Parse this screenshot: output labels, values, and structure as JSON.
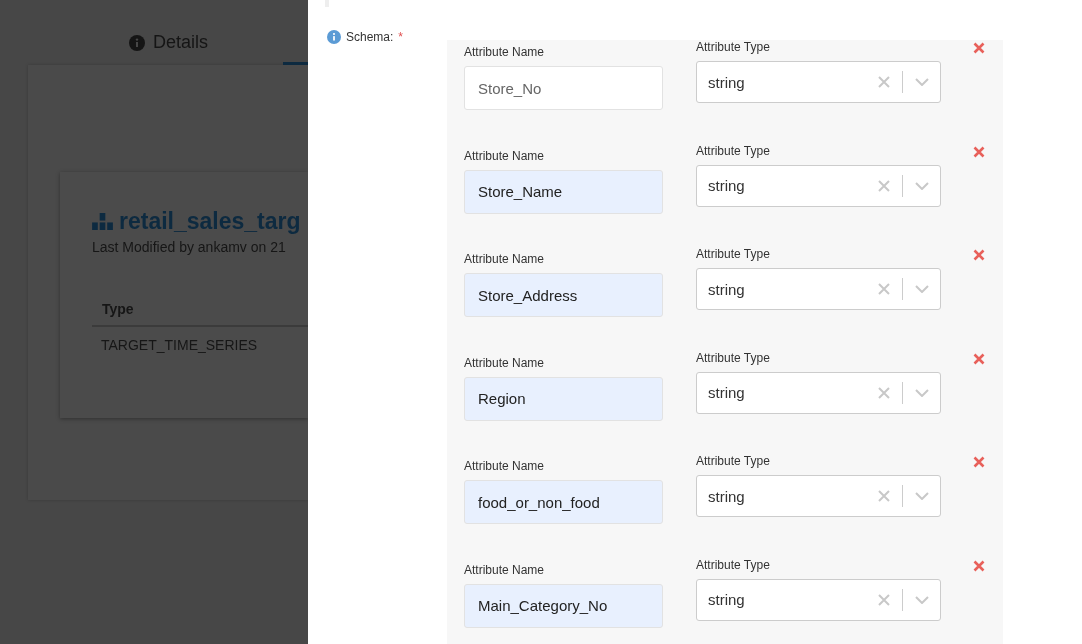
{
  "background_page": {
    "tab": {
      "label": "Details"
    },
    "dataset": {
      "title": "retail_sales_targ",
      "modified": "Last Modified by ankamv on 21"
    },
    "table": {
      "columns": [
        "Type"
      ],
      "rows": [
        [
          "TARGET_TIME_SERIES"
        ]
      ]
    }
  },
  "drawer": {
    "schema_label": "Schema:",
    "required_mark": "*",
    "attributes": [
      {
        "name_label": "Attribute Name",
        "name": "Store_No",
        "autofilled": false,
        "type_label": "Attribute Type",
        "type": "string"
      },
      {
        "name_label": "Attribute Name",
        "name": "Store_Name",
        "autofilled": true,
        "type_label": "Attribute Type",
        "type": "string"
      },
      {
        "name_label": "Attribute Name",
        "name": "Store_Address",
        "autofilled": true,
        "type_label": "Attribute Type",
        "type": "string"
      },
      {
        "name_label": "Attribute Name",
        "name": "Region",
        "autofilled": true,
        "type_label": "Attribute Type",
        "type": "string"
      },
      {
        "name_label": "Attribute Name",
        "name": "food_or_non_food",
        "autofilled": true,
        "type_label": "Attribute Type",
        "type": "string"
      },
      {
        "name_label": "Attribute Name",
        "name": "Main_Category_No",
        "autofilled": true,
        "type_label": "Attribute Type",
        "type": "string"
      }
    ]
  }
}
